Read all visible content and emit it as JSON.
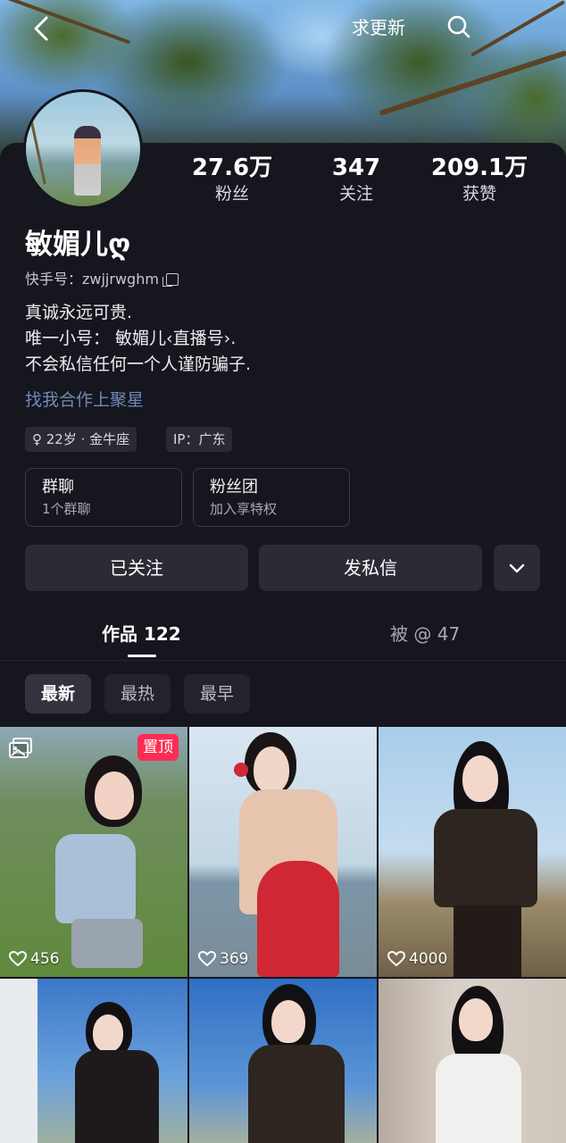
{
  "header": {
    "back_icon": "chevron-left-icon",
    "request_update": "求更新",
    "search_icon": "search-icon"
  },
  "profile": {
    "stats": [
      {
        "value": "27.6万",
        "label": "粉丝"
      },
      {
        "value": "347",
        "label": "关注"
      },
      {
        "value": "209.1万",
        "label": "获赞"
      }
    ],
    "nickname": "敏媚儿ღ",
    "uid_label": "快手号：zwjjrwghm",
    "bio": [
      "真诚永远可贵.",
      "唯一小号： 敏媚儿‹直播号›.",
      "不会私信任何一个人谨防骗子."
    ],
    "collab_link": "找我合作上聚星",
    "tags": [
      "♀ 22岁 · 金牛座",
      "IP：广东"
    ],
    "features": [
      {
        "title": "群聊",
        "sub": "1个群聊"
      },
      {
        "title": "粉丝团",
        "sub": "加入享特权"
      }
    ],
    "follow_button": "已关注",
    "message_button": "发私信"
  },
  "tabs": {
    "works": "作品 122",
    "mentions": "被 @ 47"
  },
  "sort": [
    "最新",
    "最热",
    "最早"
  ],
  "grid": {
    "pinned_label": "置顶",
    "items": [
      {
        "likes": "456"
      },
      {
        "likes": "369"
      },
      {
        "likes": "4000"
      },
      {
        "likes": ""
      },
      {
        "likes": ""
      },
      {
        "likes": ""
      }
    ]
  },
  "colors": {
    "background": "#16161e",
    "accent_pin": "#fe2c55",
    "link": "#6f8ab8"
  }
}
